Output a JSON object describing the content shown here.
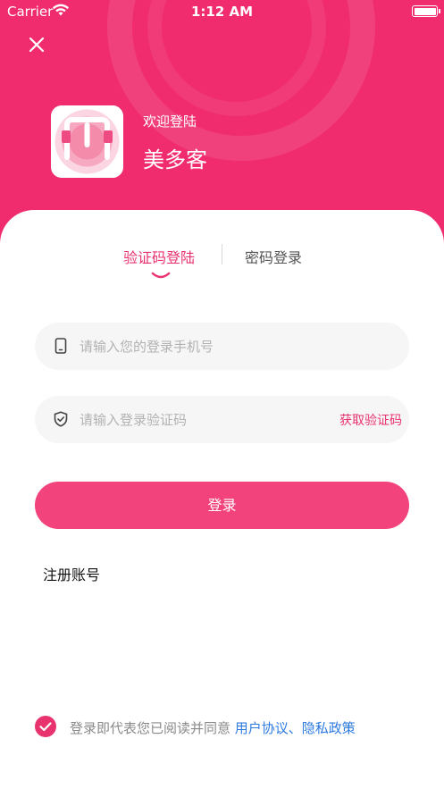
{
  "status_bar": {
    "carrier": "Carrier",
    "time": "1:12 AM"
  },
  "header": {
    "welcome": "欢迎登陆",
    "app_name": "美多客",
    "background_color": "#f02c6e",
    "close_icon": "close-icon",
    "logo_icon": "app-logo-icon"
  },
  "tabs": [
    {
      "label": "验证码登陆",
      "active": true
    },
    {
      "label": "密码登录",
      "active": false
    }
  ],
  "form": {
    "phone": {
      "placeholder": "请输入您的登录手机号",
      "value": "",
      "icon": "phone-icon"
    },
    "code": {
      "placeholder": "请输入登录验证码",
      "value": "",
      "icon": "shield-icon",
      "get_code_label": "获取验证码"
    },
    "login_label": "登录",
    "register_label": "注册账号"
  },
  "agreement": {
    "checked": true,
    "text": "登录即代表您已阅读并同意 ",
    "links": "用户协议、隐私政策"
  },
  "colors": {
    "accent": "#e8336f",
    "button": "#f2437c",
    "link": "#2d7be0"
  }
}
